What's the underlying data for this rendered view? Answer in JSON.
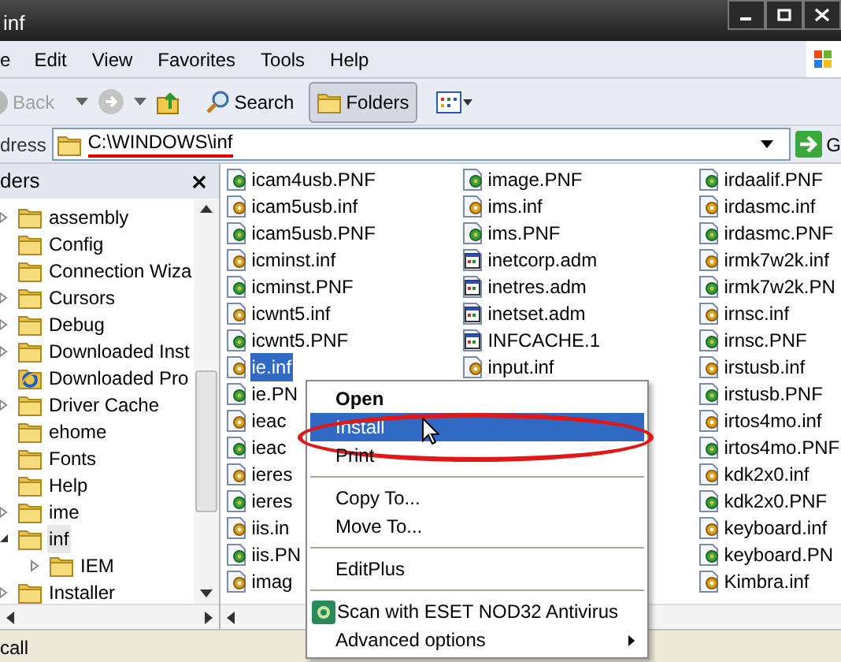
{
  "window": {
    "title": "inf"
  },
  "menu_bar": [
    "e",
    "Edit",
    "View",
    "Favorites",
    "Tools",
    "Help"
  ],
  "toolbar": {
    "back": {
      "label": "Back",
      "disabled": true
    },
    "search": {
      "label": "Search"
    },
    "folders": {
      "label": "Folders",
      "selected": true
    }
  },
  "address_bar": {
    "label": "dress",
    "path": "C:\\WINDOWS\\inf",
    "underlined": true,
    "go": "G"
  },
  "folders_pane": {
    "title": "ders",
    "tree": [
      {
        "label": "assembly",
        "kind": "folder",
        "expanded": false,
        "selected": false
      },
      {
        "label": "Config",
        "kind": "folder",
        "selected": false
      },
      {
        "label": "Connection Wiza",
        "kind": "folder",
        "selected": false
      },
      {
        "label": "Cursors",
        "kind": "folder",
        "expanded": false,
        "selected": false
      },
      {
        "label": "Debug",
        "kind": "folder",
        "expanded": false,
        "selected": false
      },
      {
        "label": "Downloaded Inst",
        "kind": "folder",
        "expanded": false,
        "selected": false
      },
      {
        "label": "Downloaded Pro",
        "kind": "browser-folder",
        "selected": false
      },
      {
        "label": "Driver Cache",
        "kind": "folder",
        "expanded": false,
        "selected": false
      },
      {
        "label": "ehome",
        "kind": "folder",
        "selected": false
      },
      {
        "label": "Fonts",
        "kind": "folder",
        "selected": false
      },
      {
        "label": "Help",
        "kind": "folder",
        "selected": false
      },
      {
        "label": "ime",
        "kind": "folder",
        "expanded": false,
        "selected": false
      },
      {
        "label": "inf",
        "kind": "folder",
        "expanded": true,
        "selected": true,
        "children": [
          {
            "label": "IEM",
            "kind": "folder",
            "expanded": false,
            "selected": false
          }
        ]
      },
      {
        "label": "Installer",
        "kind": "folder",
        "expanded": false,
        "selected": false
      }
    ]
  },
  "file_columns": [
    {
      "files": [
        {
          "name": "icam4usb.PNF",
          "kind": "pnf",
          "selected": false
        },
        {
          "name": "icam5usb.inf",
          "kind": "inf",
          "selected": false
        },
        {
          "name": "icam5usb.PNF",
          "kind": "pnf",
          "selected": false
        },
        {
          "name": "icminst.inf",
          "kind": "inf",
          "selected": false
        },
        {
          "name": "icminst.PNF",
          "kind": "pnf",
          "selected": false
        },
        {
          "name": "icwnt5.inf",
          "kind": "inf",
          "selected": false
        },
        {
          "name": "icwnt5.PNF",
          "kind": "pnf",
          "selected": false
        },
        {
          "name": "ie.inf",
          "kind": "inf",
          "selected": true
        },
        {
          "name": "ie.PN",
          "kind": "pnf",
          "selected": false
        },
        {
          "name": "ieac",
          "kind": "inf",
          "selected": false
        },
        {
          "name": "ieac",
          "kind": "pnf",
          "selected": false
        },
        {
          "name": "ieres",
          "kind": "inf",
          "selected": false
        },
        {
          "name": "ieres",
          "kind": "pnf",
          "selected": false
        },
        {
          "name": "iis.in",
          "kind": "inf",
          "selected": false
        },
        {
          "name": "iis.PN",
          "kind": "pnf",
          "selected": false
        },
        {
          "name": "imag",
          "kind": "inf",
          "selected": false
        }
      ]
    },
    {
      "files": [
        {
          "name": "image.PNF",
          "kind": "pnf",
          "selected": false
        },
        {
          "name": "ims.inf",
          "kind": "inf",
          "selected": false
        },
        {
          "name": "ims.PNF",
          "kind": "pnf",
          "selected": false
        },
        {
          "name": "inetcorp.adm",
          "kind": "adm",
          "selected": false
        },
        {
          "name": "inetres.adm",
          "kind": "adm",
          "selected": false
        },
        {
          "name": "inetset.adm",
          "kind": "adm",
          "selected": false
        },
        {
          "name": "INFCACHE.1",
          "kind": "adm",
          "selected": false
        },
        {
          "name": "input.inf",
          "kind": "inf",
          "selected": false
        }
      ]
    },
    {
      "files": [
        {
          "name": "irdaalif.PNF",
          "kind": "pnf",
          "selected": false
        },
        {
          "name": "irdasmc.inf",
          "kind": "inf",
          "selected": false
        },
        {
          "name": "irdasmc.PNF",
          "kind": "pnf",
          "selected": false
        },
        {
          "name": "irmk7w2k.inf",
          "kind": "inf",
          "selected": false
        },
        {
          "name": "irmk7w2k.PN",
          "kind": "pnf",
          "selected": false
        },
        {
          "name": "irnsc.inf",
          "kind": "inf",
          "selected": false
        },
        {
          "name": "irnsc.PNF",
          "kind": "pnf",
          "selected": false
        },
        {
          "name": "irstusb.inf",
          "kind": "inf",
          "selected": false
        },
        {
          "name": "irstusb.PNF",
          "kind": "pnf",
          "selected": false
        },
        {
          "name": "irtos4mo.inf",
          "kind": "inf",
          "selected": false
        },
        {
          "name": "irtos4mo.PNF",
          "kind": "pnf",
          "selected": false
        },
        {
          "name": "kdk2x0.inf",
          "kind": "inf",
          "selected": false
        },
        {
          "name": "kdk2x0.PNF",
          "kind": "pnf",
          "selected": false
        },
        {
          "name": "keyboard.inf",
          "kind": "inf",
          "selected": false
        },
        {
          "name": "keyboard.PN",
          "kind": "pnf",
          "selected": false
        },
        {
          "name": "Kimbra.inf",
          "kind": "inf",
          "selected": false
        }
      ]
    }
  ],
  "context_menu": [
    {
      "kind": "item",
      "label": "Open",
      "default": true,
      "selected": false,
      "circled": false
    },
    {
      "kind": "item",
      "label": "Install",
      "default": false,
      "selected": true,
      "circled": true
    },
    {
      "kind": "item",
      "label": "Print",
      "default": false,
      "selected": false,
      "circled": false
    },
    {
      "kind": "separator"
    },
    {
      "kind": "item",
      "label": "Copy To...",
      "default": false,
      "selected": false,
      "circled": false
    },
    {
      "kind": "item",
      "label": "Move To...",
      "default": false,
      "selected": false,
      "circled": false
    },
    {
      "kind": "separator"
    },
    {
      "kind": "item",
      "label": "EditPlus",
      "default": false,
      "selected": false,
      "circled": false
    },
    {
      "kind": "separator"
    },
    {
      "kind": "icon-item",
      "label": "Scan with ESET NOD32 Antivirus",
      "default": false,
      "selected": false,
      "circled": false
    },
    {
      "kind": "submenu",
      "label": "Advanced options",
      "default": false,
      "selected": false,
      "circled": false
    }
  ],
  "status_bar": "call"
}
